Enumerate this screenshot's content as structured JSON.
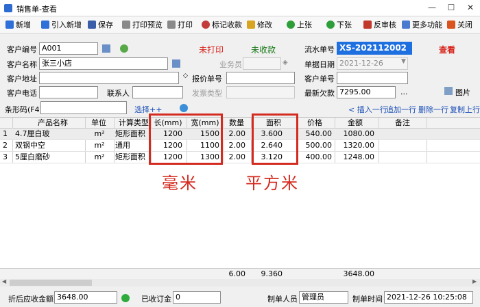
{
  "window": {
    "title": "销售单-查看",
    "minimize": "—",
    "maximize": "☐",
    "close": "✕"
  },
  "toolbar": [
    {
      "label": "新增",
      "icon": "new-icon",
      "color": "#2f6fd8"
    },
    {
      "label": "引入新增",
      "icon": "import-icon",
      "color": "#2f6fd8"
    },
    {
      "label": "保存",
      "icon": "save-icon",
      "color": "#3b5ea8"
    },
    {
      "label": "打印预览",
      "icon": "print-preview-icon",
      "color": "#777777"
    },
    {
      "label": "打印",
      "icon": "print-icon",
      "color": "#777777"
    },
    {
      "label": "标记收款",
      "icon": "mark-payment-icon",
      "color": "#c23c3c"
    },
    {
      "label": "修改",
      "icon": "edit-icon",
      "color": "#d9a520"
    },
    {
      "label": "上张",
      "icon": "prev-icon",
      "color": "#2e9e3a"
    },
    {
      "label": "下张",
      "icon": "next-icon",
      "color": "#2e9e3a"
    },
    {
      "label": "反审核",
      "icon": "unaudit-icon",
      "color": "#c0392b"
    },
    {
      "label": "更多功能",
      "icon": "more-icon",
      "color": "#4a7bd0"
    },
    {
      "label": "关闭",
      "icon": "close-icon",
      "color": "#d9531e"
    }
  ],
  "form": {
    "customer_code_label": "客户编号",
    "customer_code": "A001",
    "customer_name_label": "客户名称",
    "customer_name": "张三小店",
    "customer_address_label": "客户地址",
    "customer_address": "",
    "customer_phone_label": "客户电话",
    "customer_phone": "",
    "contact_label": "联系人",
    "contact": "",
    "print_status": "未打印",
    "payment_status": "未收款",
    "salesman_label": "业务员",
    "salesman": "",
    "quote_no_label": "报价单号",
    "quote_no": "",
    "invoice_type_label": "发票类型",
    "invoice_type": "",
    "serial_no_label": "流水单号",
    "serial_no": "XS-202112002",
    "view_mode": "查看",
    "date_label": "单据日期",
    "date": "2021-12-26",
    "cust_order_label": "客户单号",
    "cust_order": "",
    "balance_label": "最新欠款",
    "balance": "7295.00",
    "balance_more": "...",
    "image_label": "图片"
  },
  "barcode": {
    "label": "条形码(F4)",
    "value": "",
    "select_label": "选择++"
  },
  "row_actions": {
    "insert": "插入一行",
    "add": "追加一行",
    "delete": "删除一行",
    "copy": "复制上行"
  },
  "table": {
    "headers": [
      "产品名称",
      "单位",
      "计算类型",
      "长(mm)",
      "宽(mm)",
      "数量",
      "面积",
      "价格",
      "金额",
      "备注"
    ],
    "rows": [
      {
        "no": "1",
        "name": "4.7厘白玻",
        "unit": "m²",
        "calc": "矩形面积",
        "length": "1200",
        "width": "1500",
        "qty": "2.00",
        "area": "3.600",
        "price": "540.00",
        "amount": "1080.00",
        "remark": ""
      },
      {
        "no": "2",
        "name": "双钢中空",
        "unit": "m²",
        "calc": "通用",
        "length": "1200",
        "width": "1100",
        "qty": "2.00",
        "area": "2.640",
        "price": "500.00",
        "amount": "1320.00",
        "remark": ""
      },
      {
        "no": "3",
        "name": "5厘白磨砂",
        "unit": "m²",
        "calc": "矩形面积",
        "length": "1200",
        "width": "1300",
        "qty": "2.00",
        "area": "3.120",
        "price": "400.00",
        "amount": "1248.00",
        "remark": ""
      }
    ],
    "totals": {
      "qty": "6.00",
      "area": "9.360",
      "amount": "3648.00"
    }
  },
  "annotations": {
    "mm": "毫米",
    "sqm": "平方米",
    "highlight_color": "#d42a1f"
  },
  "footer": {
    "discount_total_label": "折后应收金额",
    "discount_total": "3648.00",
    "deposit_label": "已收订金",
    "deposit": "0",
    "maker_label": "制单人员",
    "maker": "管理员",
    "make_time_label": "制单时间",
    "make_time": "2021-12-26 10:25:08"
  }
}
